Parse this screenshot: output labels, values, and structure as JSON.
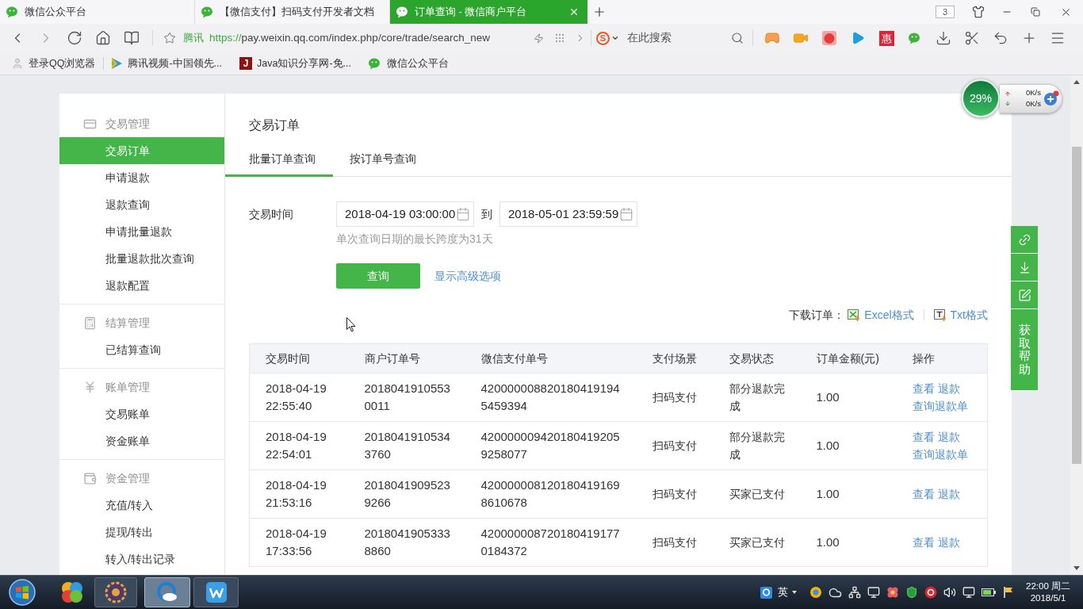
{
  "browser": {
    "tabs": [
      {
        "title": "微信公众平台",
        "selected": false
      },
      {
        "title": "【微信支付】扫码支付开发者文档",
        "selected": false
      },
      {
        "title": "订单查询 - 微信商户平台",
        "selected": true
      }
    ],
    "window_count": "3",
    "site_label": "腾讯",
    "url_scheme": "https://",
    "url_rest": "pay.weixin.qq.com/index.php/core/trade/search_new",
    "engine_mark": "S",
    "search_placeholder": "在此搜索",
    "deal_mark": "惠",
    "bookmarks": [
      {
        "kind": "user",
        "label": "登录QQ浏览器"
      },
      {
        "kind": "video",
        "label": "腾讯视频-中国领先..."
      },
      {
        "kind": "letter",
        "mark": "J",
        "label": "Java知识分享网-免..."
      },
      {
        "kind": "wechat",
        "label": "微信公众平台"
      }
    ]
  },
  "sidebar": {
    "groups": [
      {
        "kind": "trade",
        "title": "交易管理",
        "items": [
          {
            "label": "交易订单",
            "selected": true
          },
          {
            "label": "申请退款",
            "selected": false
          },
          {
            "label": "退款查询",
            "selected": false
          },
          {
            "label": "申请批量退款",
            "selected": false
          },
          {
            "label": "批量退款批次查询",
            "selected": false
          },
          {
            "label": "退款配置",
            "selected": false
          }
        ]
      },
      {
        "kind": "settle",
        "title": "结算管理",
        "items": [
          {
            "label": "已结算查询",
            "selected": false
          }
        ]
      },
      {
        "kind": "bill",
        "title": "账单管理",
        "items": [
          {
            "label": "交易账单",
            "selected": false
          },
          {
            "label": "资金账单",
            "selected": false
          }
        ]
      },
      {
        "kind": "funds",
        "title": "资金管理",
        "items": [
          {
            "label": "充值/转入",
            "selected": false
          },
          {
            "label": "提现/转出",
            "selected": false
          },
          {
            "label": "转入/转出记录",
            "selected": false
          }
        ]
      }
    ]
  },
  "main": {
    "title": "交易订单",
    "tabs": [
      {
        "label": "批量订单查询",
        "selected": true
      },
      {
        "label": "按订单号查询",
        "selected": false
      }
    ],
    "filter": {
      "label": "交易时间",
      "start": "2018-04-19 03:00:00",
      "separator": "到",
      "end": "2018-05-01 23:59:59",
      "hint": "单次查询日期的最长跨度为31天",
      "submit": "查询",
      "advanced_link": "显示高级选项"
    },
    "download": {
      "label": "下载订单：",
      "formats": [
        {
          "kind": "excel",
          "label": "Excel格式"
        },
        {
          "kind": "txt",
          "label": "Txt格式"
        }
      ]
    },
    "table": {
      "columns": [
        "交易时间",
        "商户订单号",
        "微信支付单号",
        "支付场景",
        "交易状态",
        "订单金额(元)",
        "操作"
      ],
      "rows": [
        {
          "time": "2018-04-19 22:55:40",
          "merchant_order_no": "20180419105530011",
          "wechat_order_no": "4200000088201804191945459394",
          "scene": "扫码支付",
          "status": "部分退款完成",
          "amount": "1.00",
          "actions": [
            "查看",
            "退款",
            "查询退款单"
          ]
        },
        {
          "time": "2018-04-19 22:54:01",
          "merchant_order_no": "20180419105343760",
          "wechat_order_no": "4200000094201804192059258077",
          "scene": "扫码支付",
          "status": "部分退款完成",
          "amount": "1.00",
          "actions": [
            "查看",
            "退款",
            "查询退款单"
          ]
        },
        {
          "time": "2018-04-19 21:53:16",
          "merchant_order_no": "20180419095239266",
          "wechat_order_no": "4200000081201804191698610678",
          "scene": "扫码支付",
          "status": "买家已支付",
          "amount": "1.00",
          "actions": [
            "查看",
            "退款"
          ]
        },
        {
          "time": "2018-04-19 17:33:56",
          "merchant_order_no": "20180419053338860",
          "wechat_order_no": "4200000087201804191770184372",
          "scene": "扫码支付",
          "status": "买家已支付",
          "amount": "1.00",
          "actions": [
            "查看",
            "退款"
          ]
        }
      ]
    }
  },
  "side_tools": {
    "help_label": "获取帮助"
  },
  "speed_widget": {
    "percent": "29%",
    "upload": "0K/s",
    "download": "0K/s"
  },
  "taskbar": {
    "ime": "英",
    "time": "22:00 周二",
    "date": "2018/5/1"
  }
}
